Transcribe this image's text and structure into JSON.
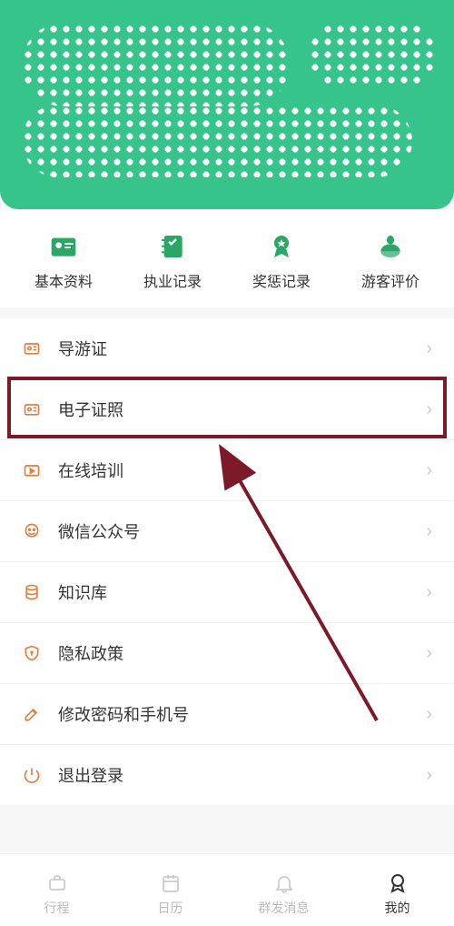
{
  "cards": {
    "basic_info": "基本资料",
    "practice_record": "执业记录",
    "reward_punish": "奖惩记录",
    "visitor_review": "游客评价"
  },
  "menu": {
    "guide_cert": "导游证",
    "e_cert": "电子证照",
    "online_training": "在线培训",
    "wechat_official": "微信公众号",
    "knowledge_base": "知识库",
    "privacy_policy": "隐私政策",
    "change_password": "修改密码和手机号",
    "logout": "退出登录"
  },
  "nav": {
    "itinerary": "行程",
    "calendar": "日历",
    "group_msg": "群发消息",
    "mine": "我的"
  }
}
